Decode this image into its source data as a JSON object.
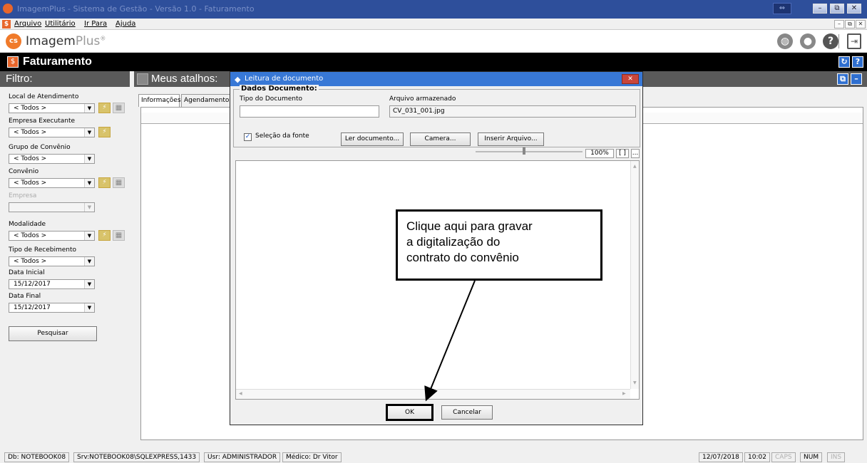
{
  "window": {
    "title": "ImagemPlus - Sistema de Gestão - Versão 1.0 - Faturamento",
    "extra_btn": "⇔",
    "btns": [
      "–",
      "⧉",
      "✕"
    ]
  },
  "menu": {
    "items": [
      "Arquivo",
      "Utilitário",
      "Ir Para",
      "Ajuda"
    ],
    "mdi_btns": [
      "–",
      "⧉",
      "✕"
    ]
  },
  "logo": {
    "mark": "cs",
    "name": "Imagem",
    "suffix": "Plus",
    "reg": "®"
  },
  "topicons": {
    "globe": "◍",
    "user": "●",
    "help": "?",
    "exit": "⇥"
  },
  "module": {
    "title": "Faturamento",
    "btn_refresh": "↻",
    "btn_help": "?"
  },
  "filter": {
    "header": "Filtro:",
    "local_label": "Local de Atendimento",
    "local_value": "< Todos >",
    "empresa_exec_label": "Empresa Executante",
    "empresa_exec_value": "< Todos >",
    "grupo_label": "Grupo de Convênio",
    "grupo_value": "< Todos >",
    "convenio_label": "Convênio",
    "convenio_value": "< Todos >",
    "empresa_label": "Empresa",
    "empresa_value": "",
    "modalidade_label": "Modalidade",
    "modalidade_value": "< Todos >",
    "tipo_receb_label": "Tipo de Recebimento",
    "tipo_receb_value": "< Todos >",
    "data_ini_label": "Data Inicial",
    "data_ini_value": "15/12/2017",
    "data_fim_label": "Data Final",
    "data_fim_value": "15/12/2017",
    "pesquisar": "Pesquisar"
  },
  "atalhos": {
    "header": "Meus atalhos:",
    "tabs": [
      "Informações",
      "Agendamento"
    ]
  },
  "right_panel_btns": [
    "⧉",
    "–"
  ],
  "dialog": {
    "title": "Leitura de documento",
    "group_title": "Dados Documento:",
    "tipo_label": "Tipo do Documento",
    "tipo_value": "",
    "arquivo_label": "Arquivo armazenado",
    "arquivo_value": "CV_031_001.jpg",
    "selecao_label": "Seleção da fonte",
    "selecao_checked": true,
    "btn_ler": "Ler documento...",
    "btn_camera": "Camera...",
    "btn_inserir": "Inserir Arquivo...",
    "zoom": "100%",
    "fit": "[ ]",
    "more": "...",
    "ok": "OK",
    "cancel": "Cancelar",
    "close": "✕"
  },
  "callout": {
    "lines": [
      "Clique aqui para gravar",
      "a digitalização do",
      "contrato do convênio"
    ]
  },
  "status": {
    "db": "Db: NOTEBOOK08",
    "srv": "Srv:NOTEBOOK08\\SQLEXPRESS,1433",
    "usr": "Usr: ADMINISTRADOR",
    "medico": "Médico: Dr Vitor",
    "date": "12/07/2018",
    "time": "10:02",
    "caps": "CAPS",
    "num": "NUM",
    "ins": "INS"
  }
}
